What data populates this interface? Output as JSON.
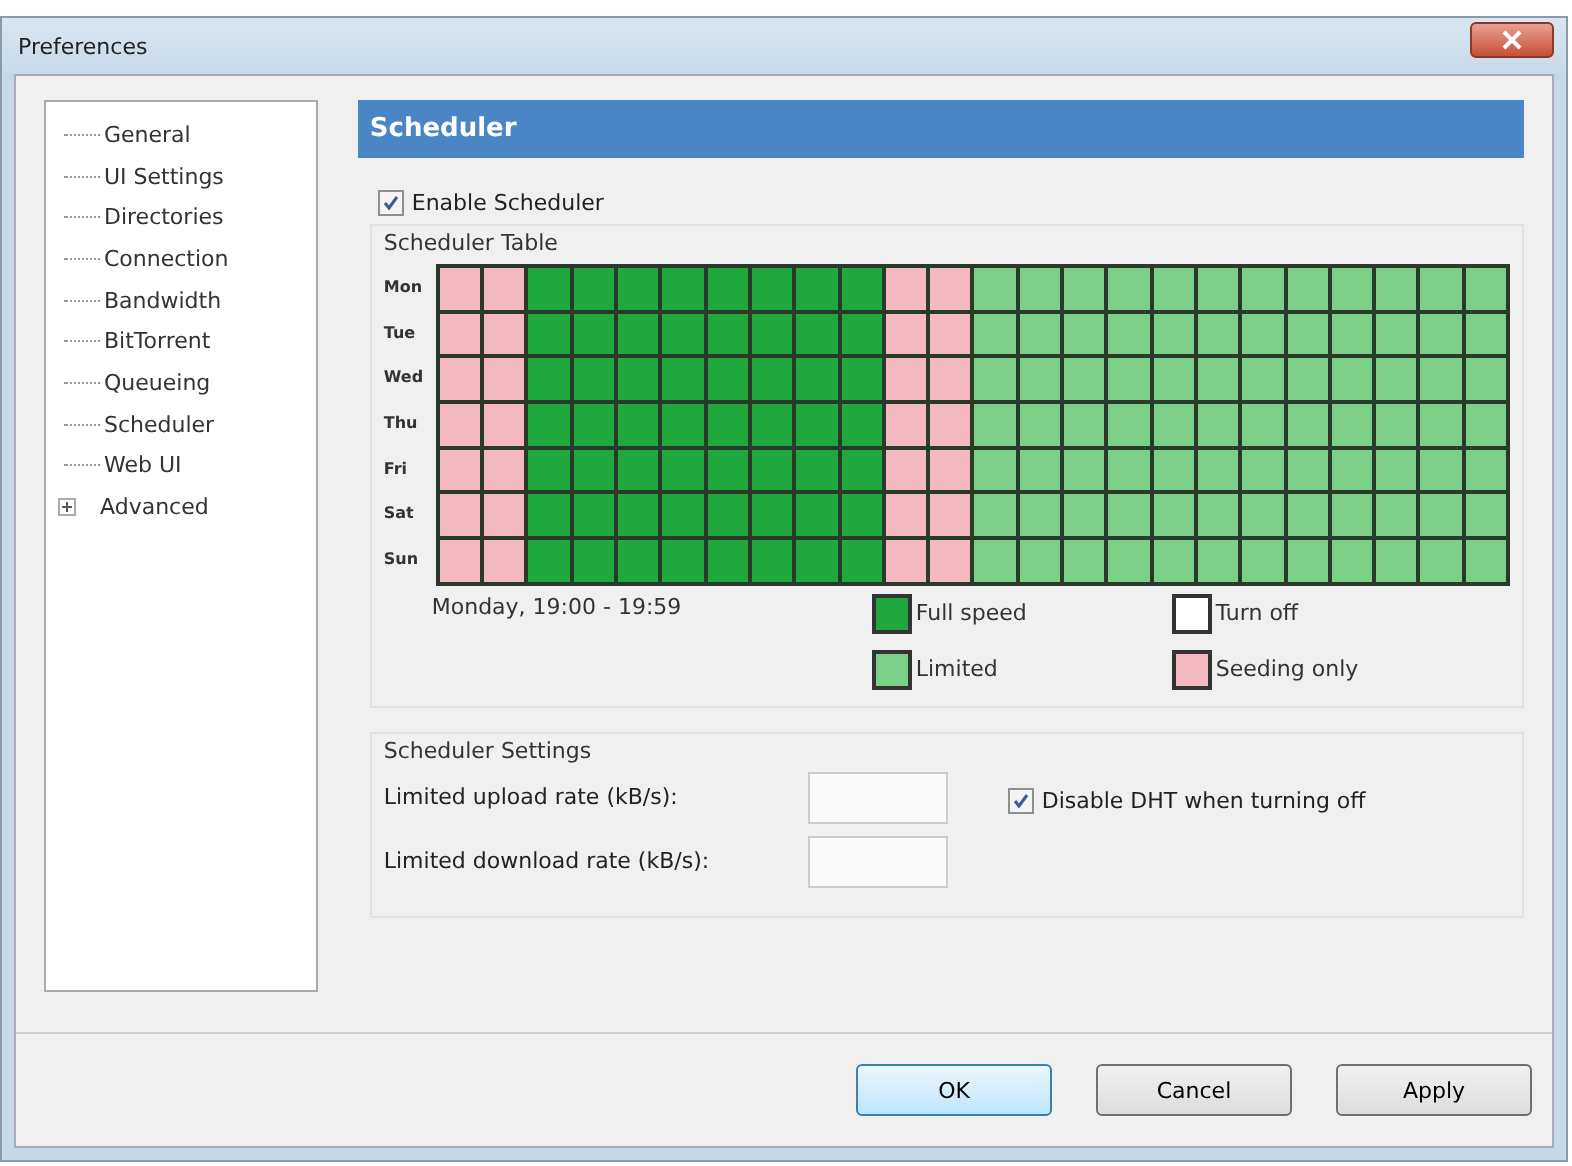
{
  "window": {
    "title": "Preferences"
  },
  "sidebar": {
    "items": [
      {
        "label": "General",
        "selected": false
      },
      {
        "label": "UI Settings",
        "selected": false
      },
      {
        "label": "Directories",
        "selected": false
      },
      {
        "label": "Connection",
        "selected": false
      },
      {
        "label": "Bandwidth",
        "selected": false
      },
      {
        "label": "BitTorrent",
        "selected": false
      },
      {
        "label": "Queueing",
        "selected": false
      },
      {
        "label": "Scheduler",
        "selected": false
      },
      {
        "label": "Web UI",
        "selected": false
      },
      {
        "label": "Advanced",
        "selected": false,
        "expanded": false
      }
    ]
  },
  "header": "Scheduler",
  "enable_scheduler": {
    "label": "Enable Scheduler",
    "checked": true
  },
  "table": {
    "title": "Scheduler Table",
    "rows": [
      {
        "day": "Mon",
        "cells": [
          {
            "kind": "seeding"
          },
          {
            "kind": "seeding"
          },
          {
            "kind": "full"
          },
          {
            "kind": "full"
          },
          {
            "kind": "full"
          },
          {
            "kind": "full"
          },
          {
            "kind": "full"
          },
          {
            "kind": "full"
          },
          {
            "kind": "full"
          },
          {
            "kind": "full"
          },
          {
            "kind": "seeding"
          },
          {
            "kind": "seeding"
          },
          {
            "kind": "limited"
          },
          {
            "kind": "limited"
          },
          {
            "kind": "limited"
          },
          {
            "kind": "limited"
          },
          {
            "kind": "limited"
          },
          {
            "kind": "limited"
          },
          {
            "kind": "limited"
          },
          {
            "kind": "limited"
          },
          {
            "kind": "limited"
          },
          {
            "kind": "limited"
          },
          {
            "kind": "limited"
          },
          {
            "kind": "limited"
          }
        ]
      },
      {
        "day": "Tue",
        "cells": [
          {
            "kind": "seeding"
          },
          {
            "kind": "seeding"
          },
          {
            "kind": "full"
          },
          {
            "kind": "full"
          },
          {
            "kind": "full"
          },
          {
            "kind": "full"
          },
          {
            "kind": "full"
          },
          {
            "kind": "full"
          },
          {
            "kind": "full"
          },
          {
            "kind": "full"
          },
          {
            "kind": "seeding"
          },
          {
            "kind": "seeding"
          },
          {
            "kind": "limited"
          },
          {
            "kind": "limited"
          },
          {
            "kind": "limited"
          },
          {
            "kind": "limited"
          },
          {
            "kind": "limited"
          },
          {
            "kind": "limited"
          },
          {
            "kind": "limited"
          },
          {
            "kind": "limited"
          },
          {
            "kind": "limited"
          },
          {
            "kind": "limited"
          },
          {
            "kind": "limited"
          },
          {
            "kind": "limited"
          }
        ]
      },
      {
        "day": "Wed",
        "cells": [
          {
            "kind": "seeding"
          },
          {
            "kind": "seeding"
          },
          {
            "kind": "full"
          },
          {
            "kind": "full"
          },
          {
            "kind": "full"
          },
          {
            "kind": "full"
          },
          {
            "kind": "full"
          },
          {
            "kind": "full"
          },
          {
            "kind": "full"
          },
          {
            "kind": "full"
          },
          {
            "kind": "seeding"
          },
          {
            "kind": "seeding"
          },
          {
            "kind": "limited"
          },
          {
            "kind": "limited"
          },
          {
            "kind": "limited"
          },
          {
            "kind": "limited"
          },
          {
            "kind": "limited"
          },
          {
            "kind": "limited"
          },
          {
            "kind": "limited"
          },
          {
            "kind": "limited"
          },
          {
            "kind": "limited"
          },
          {
            "kind": "limited"
          },
          {
            "kind": "limited"
          },
          {
            "kind": "limited"
          }
        ]
      },
      {
        "day": "Thu",
        "cells": [
          {
            "kind": "seeding"
          },
          {
            "kind": "seeding"
          },
          {
            "kind": "full"
          },
          {
            "kind": "full"
          },
          {
            "kind": "full"
          },
          {
            "kind": "full"
          },
          {
            "kind": "full"
          },
          {
            "kind": "full"
          },
          {
            "kind": "full"
          },
          {
            "kind": "full"
          },
          {
            "kind": "seeding"
          },
          {
            "kind": "seeding"
          },
          {
            "kind": "limited"
          },
          {
            "kind": "limited"
          },
          {
            "kind": "limited"
          },
          {
            "kind": "limited"
          },
          {
            "kind": "limited"
          },
          {
            "kind": "limited"
          },
          {
            "kind": "limited"
          },
          {
            "kind": "limited"
          },
          {
            "kind": "limited"
          },
          {
            "kind": "limited"
          },
          {
            "kind": "limited"
          },
          {
            "kind": "limited"
          }
        ]
      },
      {
        "day": "Fri",
        "cells": [
          {
            "kind": "seeding"
          },
          {
            "kind": "seeding"
          },
          {
            "kind": "full"
          },
          {
            "kind": "full"
          },
          {
            "kind": "full"
          },
          {
            "kind": "full"
          },
          {
            "kind": "full"
          },
          {
            "kind": "full"
          },
          {
            "kind": "full"
          },
          {
            "kind": "full"
          },
          {
            "kind": "seeding"
          },
          {
            "kind": "seeding"
          },
          {
            "kind": "limited"
          },
          {
            "kind": "limited"
          },
          {
            "kind": "limited"
          },
          {
            "kind": "limited"
          },
          {
            "kind": "limited"
          },
          {
            "kind": "limited"
          },
          {
            "kind": "limited"
          },
          {
            "kind": "limited"
          },
          {
            "kind": "limited"
          },
          {
            "kind": "limited"
          },
          {
            "kind": "limited"
          },
          {
            "kind": "limited"
          }
        ]
      },
      {
        "day": "Sat",
        "cells": [
          {
            "kind": "seeding"
          },
          {
            "kind": "seeding"
          },
          {
            "kind": "full"
          },
          {
            "kind": "full"
          },
          {
            "kind": "full"
          },
          {
            "kind": "full"
          },
          {
            "kind": "full"
          },
          {
            "kind": "full"
          },
          {
            "kind": "full"
          },
          {
            "kind": "full"
          },
          {
            "kind": "seeding"
          },
          {
            "kind": "seeding"
          },
          {
            "kind": "limited"
          },
          {
            "kind": "limited"
          },
          {
            "kind": "limited"
          },
          {
            "kind": "limited"
          },
          {
            "kind": "limited"
          },
          {
            "kind": "limited"
          },
          {
            "kind": "limited"
          },
          {
            "kind": "limited"
          },
          {
            "kind": "limited"
          },
          {
            "kind": "limited"
          },
          {
            "kind": "limited"
          },
          {
            "kind": "limited"
          }
        ]
      },
      {
        "day": "Sun",
        "cells": [
          {
            "kind": "seeding"
          },
          {
            "kind": "seeding"
          },
          {
            "kind": "full"
          },
          {
            "kind": "full"
          },
          {
            "kind": "full"
          },
          {
            "kind": "full"
          },
          {
            "kind": "full"
          },
          {
            "kind": "full"
          },
          {
            "kind": "full"
          },
          {
            "kind": "full"
          },
          {
            "kind": "seeding"
          },
          {
            "kind": "seeding"
          },
          {
            "kind": "limited"
          },
          {
            "kind": "limited"
          },
          {
            "kind": "limited"
          },
          {
            "kind": "limited"
          },
          {
            "kind": "limited"
          },
          {
            "kind": "limited"
          },
          {
            "kind": "limited"
          },
          {
            "kind": "limited"
          },
          {
            "kind": "limited"
          },
          {
            "kind": "limited"
          },
          {
            "kind": "limited"
          },
          {
            "kind": "limited"
          }
        ]
      }
    ],
    "status": "Monday, 19:00 - 19:59",
    "legend": [
      {
        "label": "Full speed",
        "color": "#1fa83e"
      },
      {
        "label": "Turn off",
        "color": "#ffffff"
      },
      {
        "label": "Limited",
        "color": "#7ccf87"
      },
      {
        "label": "Seeding only",
        "color": "#f4b8c0"
      }
    ]
  },
  "settings": {
    "title": "Scheduler Settings",
    "fields": [
      {
        "label": "Limited upload rate (kB/s):"
      },
      {
        "label": "Limited download rate (kB/s):"
      }
    ],
    "disable_dht": {
      "label": "Disable DHT when turning off",
      "checked": true
    }
  },
  "buttons": [
    {
      "label": "OK",
      "default": true
    },
    {
      "label": "Cancel",
      "default": false
    },
    {
      "label": "Apply",
      "default": false
    }
  ]
}
